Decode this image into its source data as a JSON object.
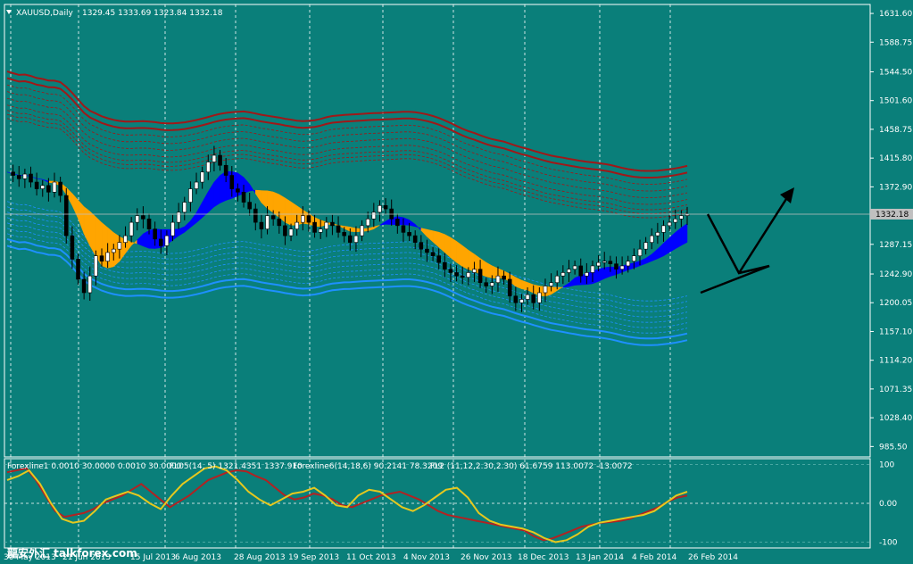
{
  "colors": {
    "background": "#0a7f7a",
    "frame": "#000000",
    "grid": "#ffffff",
    "candle": "#ffffff",
    "candle_outline": "#000000",
    "orange_band": "#ffa500",
    "blue_band": "#0000ff",
    "red_envelope": "#a01818",
    "blue_envelope": "#1e90ff",
    "osc_red": "#b22222",
    "osc_yellow": "#e6c81e",
    "arrow": "#000000"
  },
  "chart_data": {
    "type": "candlestick",
    "symbol": "XAUUSD,Daily",
    "ohlc_header": "1329.45 1333.69 1323.84 1332.18",
    "ylim": [
      970,
      1645
    ],
    "y_ticks": [
      "1631.60",
      "1588.75",
      "1544.50",
      "1501.60",
      "1458.75",
      "1415.80",
      "1372.90",
      "1330.05",
      "1287.15",
      "1242.90",
      "1200.05",
      "1157.10",
      "1114.20",
      "1071.35",
      "1028.40",
      "985.50"
    ],
    "y_tick_values": [
      1631.6,
      1588.75,
      1544.5,
      1501.6,
      1458.75,
      1415.8,
      1372.9,
      1330.05,
      1287.15,
      1242.9,
      1200.05,
      1157.1,
      1114.2,
      1071.35,
      1028.4,
      985.5
    ],
    "current_price_label": "1332.18",
    "current_price": 1332.18,
    "x_labels": [
      "30 May 2013",
      "21 Jun 2013",
      "15 Jul 2013",
      "6 Aug 2013",
      "28 Aug 2013",
      "19 Sep 2013",
      "11 Oct 2013",
      "4 Nov 2013",
      "26 Nov 2013",
      "18 Dec 2013",
      "13 Jan 2014",
      "4 Feb 2014",
      "26 Feb 2014"
    ],
    "price_path": [
      1395,
      1390,
      1385,
      1392,
      1380,
      1370,
      1375,
      1365,
      1380,
      1360,
      1300,
      1265,
      1235,
      1215,
      1240,
      1270,
      1262,
      1275,
      1280,
      1290,
      1300,
      1320,
      1330,
      1325,
      1310,
      1295,
      1285,
      1300,
      1320,
      1335,
      1350,
      1370,
      1380,
      1395,
      1410,
      1420,
      1405,
      1390,
      1370,
      1365,
      1350,
      1340,
      1320,
      1310,
      1330,
      1325,
      1315,
      1300,
      1310,
      1320,
      1330,
      1320,
      1305,
      1310,
      1320,
      1315,
      1305,
      1300,
      1290,
      1300,
      1315,
      1325,
      1335,
      1345,
      1340,
      1325,
      1315,
      1305,
      1300,
      1290,
      1280,
      1275,
      1270,
      1260,
      1250,
      1245,
      1240,
      1238,
      1245,
      1250,
      1230,
      1225,
      1230,
      1240,
      1235,
      1210,
      1200,
      1205,
      1212,
      1200,
      1215,
      1225,
      1230,
      1240,
      1245,
      1250,
      1255,
      1240,
      1245,
      1255,
      1260,
      1262,
      1258,
      1250,
      1255,
      1262,
      1270,
      1280,
      1290,
      1300,
      1305,
      1315,
      1320,
      1325,
      1330,
      1332
    ],
    "indicators": {
      "text": [
        "Forexline1 0.0010 30.0000 0.0010 30.0000",
        "FL05(14, 5) 1321.4351 1337.910",
        "Forexline6(14,18,6) 90.2141 78.3209",
        "FL2 (11,12,2.30,2.30) 61.6759 113.0072 -13.0072"
      ],
      "ylim": [
        -115,
        115
      ],
      "y_ticks": [
        "100",
        "0.00",
        "-100"
      ],
      "y_tick_values": [
        100,
        0,
        -100
      ],
      "red_series": [
        80,
        85,
        90,
        60,
        20,
        -20,
        -35,
        -30,
        -25,
        -15,
        0,
        10,
        20,
        35,
        50,
        30,
        10,
        -10,
        5,
        20,
        40,
        60,
        70,
        80,
        85,
        82,
        70,
        60,
        40,
        20,
        10,
        15,
        25,
        20,
        10,
        -5,
        -10,
        0,
        10,
        20,
        25,
        30,
        20,
        10,
        -5,
        -20,
        -30,
        -35,
        -40,
        -45,
        -50,
        -55,
        -60,
        -65,
        -70,
        -85,
        -95,
        -90,
        -80,
        -70,
        -60,
        -55,
        -50,
        -48,
        -45,
        -40,
        -30,
        -20,
        -10,
        5,
        15,
        20
      ],
      "yellow_series": [
        60,
        70,
        85,
        50,
        0,
        -40,
        -50,
        -45,
        -20,
        10,
        20,
        30,
        20,
        0,
        -15,
        20,
        50,
        70,
        90,
        95,
        85,
        60,
        30,
        10,
        -5,
        10,
        25,
        30,
        40,
        20,
        -5,
        -10,
        20,
        35,
        30,
        10,
        -10,
        -20,
        -5,
        15,
        35,
        40,
        15,
        -25,
        -45,
        -55,
        -60,
        -65,
        -75,
        -90,
        -100,
        -95,
        -80,
        -60,
        -50,
        -45,
        -40,
        -35,
        -30,
        -20,
        0,
        20,
        30
      ]
    }
  },
  "watermark": "龍安外汇 talkforex.com"
}
